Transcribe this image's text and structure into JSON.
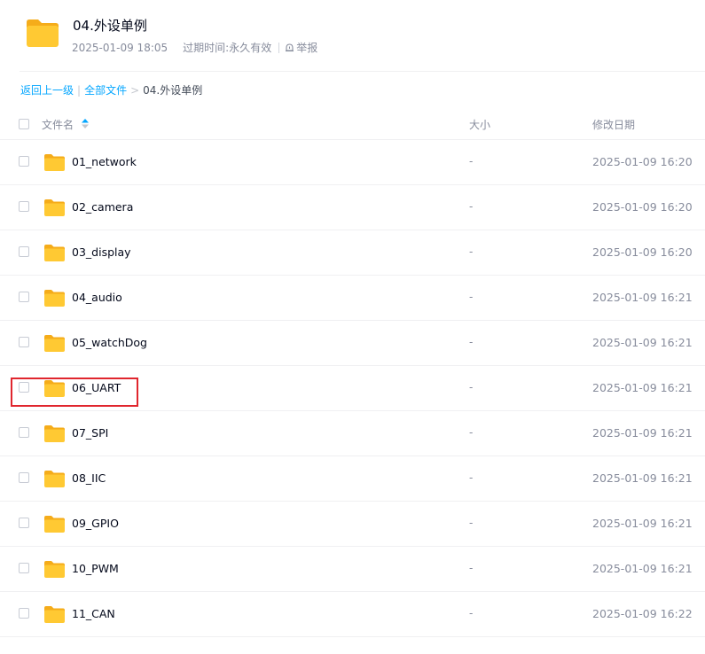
{
  "header": {
    "title": "04.外设单例",
    "created": "2025-01-09 18:05",
    "expire_label": "过期时间:",
    "expire_value": "永久有效",
    "report_label": "举报",
    "icon": "folder-icon"
  },
  "breadcrumb": {
    "back_label": "返回上一级",
    "all_files_label": "全部文件",
    "separator": "|",
    "arrow": ">",
    "current": "04.外设单例"
  },
  "columns": {
    "name": "文件名",
    "size": "大小",
    "date": "修改日期"
  },
  "colors": {
    "accent": "#06a7ff",
    "folder_yellow": "#ffc933",
    "highlight_red": "#e0262e"
  },
  "files": [
    {
      "name": "01_network",
      "size": "-",
      "date": "2025-01-09 16:20"
    },
    {
      "name": "02_camera",
      "size": "-",
      "date": "2025-01-09 16:20"
    },
    {
      "name": "03_display",
      "size": "-",
      "date": "2025-01-09 16:20"
    },
    {
      "name": "04_audio",
      "size": "-",
      "date": "2025-01-09 16:21"
    },
    {
      "name": "05_watchDog",
      "size": "-",
      "date": "2025-01-09 16:21"
    },
    {
      "name": "06_UART",
      "size": "-",
      "date": "2025-01-09 16:21",
      "highlighted": true
    },
    {
      "name": "07_SPI",
      "size": "-",
      "date": "2025-01-09 16:21"
    },
    {
      "name": "08_IIC",
      "size": "-",
      "date": "2025-01-09 16:21"
    },
    {
      "name": "09_GPIO",
      "size": "-",
      "date": "2025-01-09 16:21"
    },
    {
      "name": "10_PWM",
      "size": "-",
      "date": "2025-01-09 16:21"
    },
    {
      "name": "11_CAN",
      "size": "-",
      "date": "2025-01-09 16:22"
    }
  ]
}
